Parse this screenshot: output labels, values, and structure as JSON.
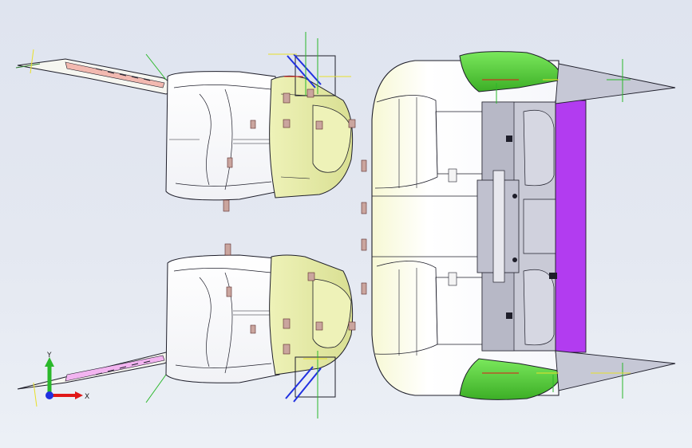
{
  "viewport": {
    "background_colors": [
      "#dfe4ef",
      "#ecf0f6"
    ],
    "model_colors": {
      "seat_shell": "#ffffff",
      "seat_trim": "#f4f4d6",
      "cushion_highlight": "#e9eeb0",
      "green_panel": "#58d23c",
      "purple_panel": "#b23cf0",
      "frame_grey": "#c8c8d4",
      "tag_marker": "#caa59e",
      "edge_line": "#1e1e2a"
    }
  },
  "triad": {
    "x_label": "X",
    "y_label": "Y",
    "x_color": "#e01818",
    "y_color": "#2ab82a",
    "z_color": "#2030e0"
  }
}
